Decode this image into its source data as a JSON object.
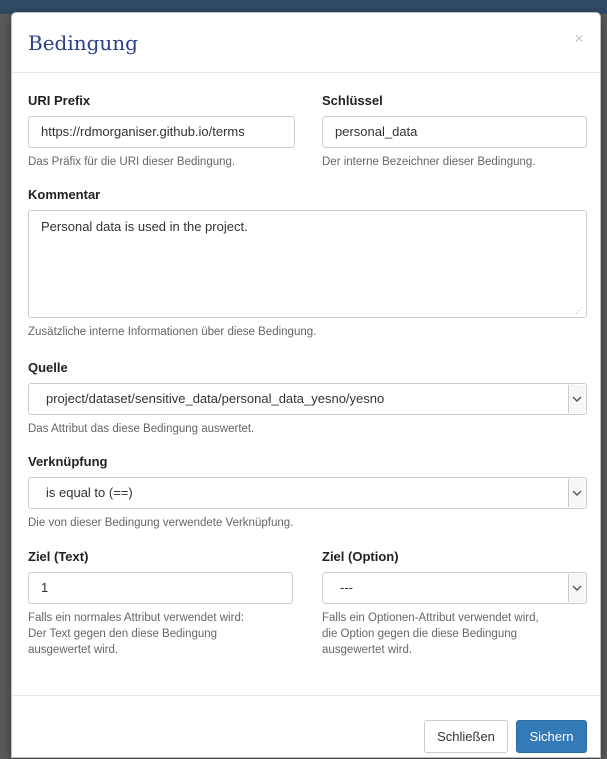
{
  "modal": {
    "title": "Bedingung",
    "close_icon": "close-icon",
    "close_glyph": "×"
  },
  "form": {
    "uri_prefix": {
      "label": "URI Prefix",
      "value": "https://rdmorganiser.github.io/terms",
      "help": "Das Präfix für die URI dieser Bedingung."
    },
    "key": {
      "label": "Schlüssel",
      "value": "personal_data",
      "help": "Der interne Bezeichner dieser Bedingung."
    },
    "comment": {
      "label": "Kommentar",
      "value": "Personal data is used in the project.",
      "help": "Zusätzliche interne Informationen über diese Bedingung."
    },
    "source": {
      "label": "Quelle",
      "value": "project/dataset/sensitive_data/personal_data_yesno/yesno",
      "help": "Das Attribut das diese Bedingung auswertet."
    },
    "relation": {
      "label": "Verknüpfung",
      "value": "is equal to (==)",
      "help": "Die von dieser Bedingung verwendete Verknüpfung."
    },
    "target_text": {
      "label": "Ziel (Text)",
      "value": "1",
      "help_lines": [
        "Falls ein normales Attribut verwendet wird:",
        "Der Text gegen den diese Bedingung",
        "ausgewertet wird."
      ]
    },
    "target_option": {
      "label": "Ziel (Option)",
      "value": "---",
      "help_lines": [
        "Falls ein Optionen-Attribut verwendet wird,",
        "die Option gegen die diese Bedingung",
        "ausgewertet wird."
      ]
    }
  },
  "footer": {
    "close_label": "Schließen",
    "save_label": "Sichern"
  },
  "colors": {
    "title": "#2b3f8a",
    "primary": "#337ab7",
    "overlay": "#5a5a5a",
    "topbar": "#2f4a63"
  }
}
